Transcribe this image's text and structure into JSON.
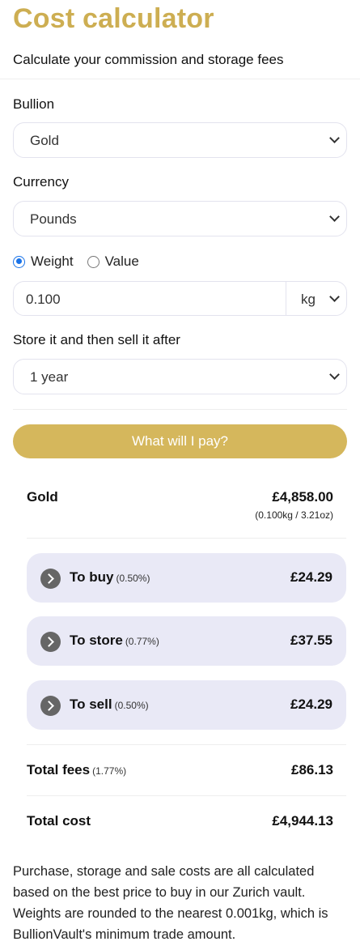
{
  "header": {
    "title": "Cost calculator",
    "subtitle": "Calculate your commission and storage fees"
  },
  "form": {
    "bullion_label": "Bullion",
    "bullion_value": "Gold",
    "currency_label": "Currency",
    "currency_value": "Pounds",
    "mode_options": [
      "Weight",
      "Value"
    ],
    "mode_selected": "Weight",
    "weight_value": "0.100",
    "weight_unit": "kg",
    "duration_label": "Store it and then sell it after",
    "duration_value": "1 year",
    "submit_label": "What will I pay?"
  },
  "results": {
    "bullion_name": "Gold",
    "bullion_price": "£4,858.00",
    "bullion_qty": "(0.100kg / 3.21oz)",
    "fees": [
      {
        "label": "To buy",
        "pct": "(0.50%)",
        "amount": "£24.29"
      },
      {
        "label": "To store",
        "pct": "(0.77%)",
        "amount": "£37.55"
      },
      {
        "label": "To sell",
        "pct": "(0.50%)",
        "amount": "£24.29"
      }
    ],
    "total_fees_label": "Total fees",
    "total_fees_pct": "(1.77%)",
    "total_fees_amount": "£86.13",
    "total_cost_label": "Total cost",
    "total_cost_amount": "£4,944.13"
  },
  "footnote": "Purchase, storage and sale costs are all calculated based on the best price to buy in our Zurich vault. Weights are rounded to the nearest 0.001kg, which is BullionVault's minimum trade amount.",
  "colors": {
    "title_gold": "#cdae52",
    "button_gold": "#d5b75c",
    "fee_card_bg": "#e9e9f6",
    "radio_blue": "#1a73e8"
  }
}
